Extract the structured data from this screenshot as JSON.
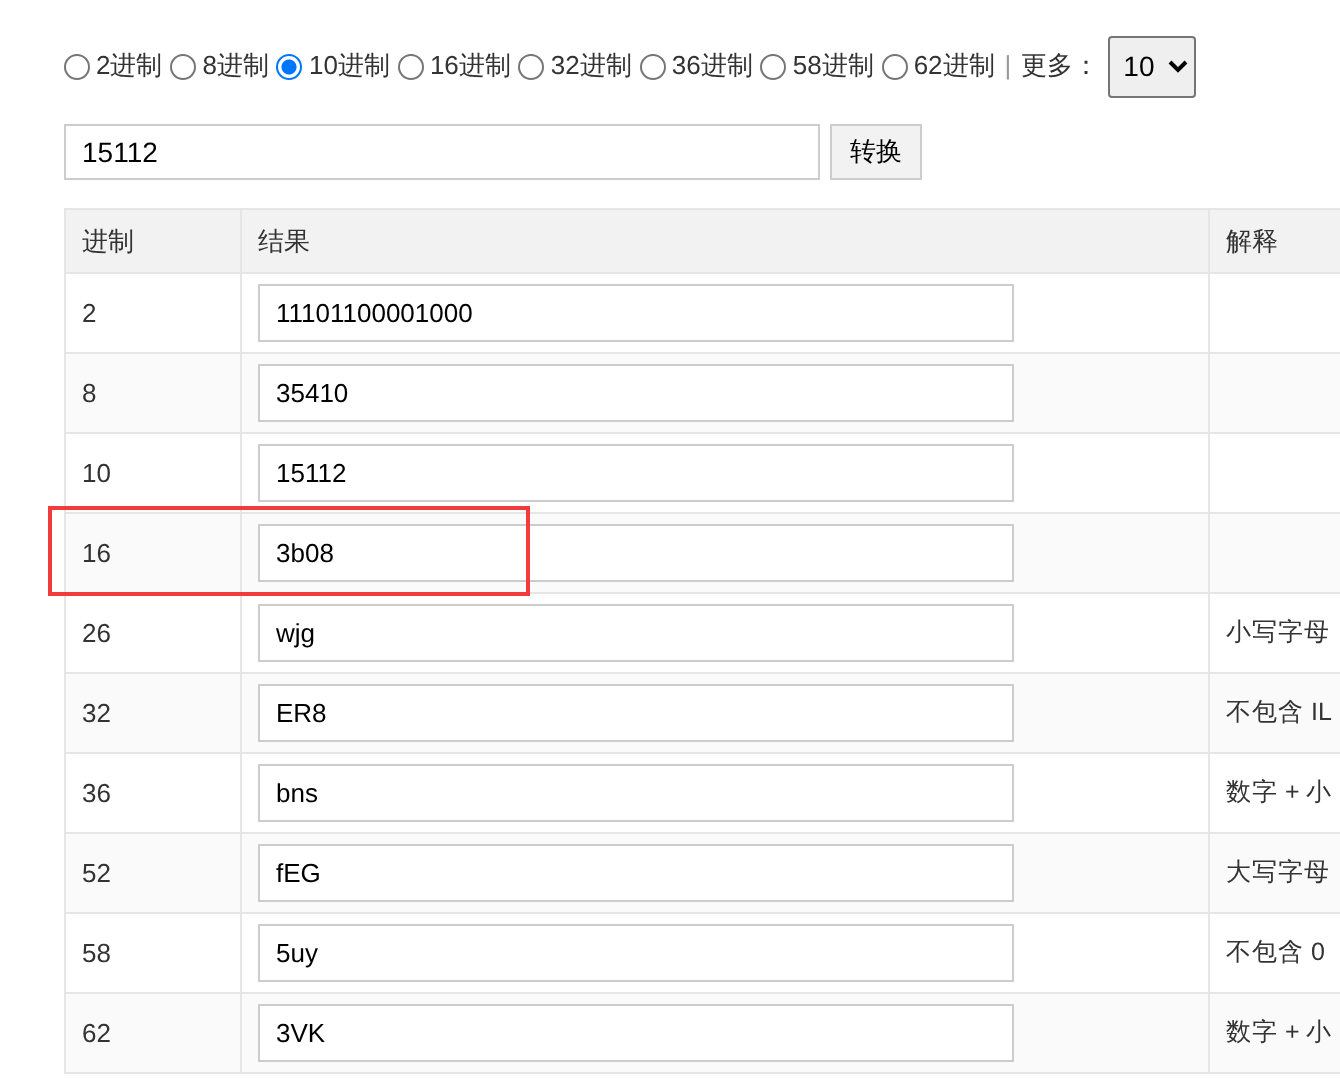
{
  "bases": [
    {
      "label": "2进制",
      "selected": false
    },
    {
      "label": "8进制",
      "selected": false
    },
    {
      "label": "10进制",
      "selected": true
    },
    {
      "label": "16进制",
      "selected": false
    },
    {
      "label": "32进制",
      "selected": false
    },
    {
      "label": "36进制",
      "selected": false
    },
    {
      "label": "58进制",
      "selected": false
    },
    {
      "label": "62进制",
      "selected": false
    }
  ],
  "separator": "|",
  "more_label": "更多：",
  "more_select": {
    "value": "10"
  },
  "input": {
    "value": "15112"
  },
  "convert_button": "转换",
  "table": {
    "columns": [
      "进制",
      "结果",
      "解释"
    ],
    "rows": [
      {
        "base": "2",
        "result": "11101100001000",
        "note": "",
        "highlighted": false
      },
      {
        "base": "8",
        "result": "35410",
        "note": "",
        "highlighted": false
      },
      {
        "base": "10",
        "result": "15112",
        "note": "",
        "highlighted": false
      },
      {
        "base": "16",
        "result": "3b08",
        "note": "",
        "highlighted": true
      },
      {
        "base": "26",
        "result": "wjg",
        "note": "小写字母",
        "highlighted": false
      },
      {
        "base": "32",
        "result": "ER8",
        "note": "不包含 IL",
        "highlighted": false
      },
      {
        "base": "36",
        "result": "bns",
        "note": "数字 + 小",
        "highlighted": false
      },
      {
        "base": "52",
        "result": "fEG",
        "note": "大写字母",
        "highlighted": false
      },
      {
        "base": "58",
        "result": "5uy",
        "note": "不包含 0",
        "highlighted": false
      },
      {
        "base": "62",
        "result": "3VK",
        "note": "数字 + 小",
        "highlighted": false
      }
    ]
  }
}
